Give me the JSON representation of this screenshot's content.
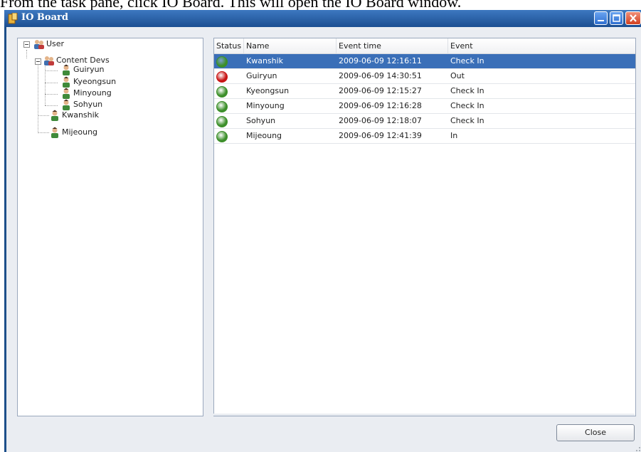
{
  "caption": "From the task pane, click IO Board. This will open the IO Board window.",
  "window": {
    "title": "IO Board"
  },
  "tree": {
    "root": {
      "label": "User"
    },
    "group": {
      "label": "Content Devs"
    },
    "group_members": [
      {
        "label": "Guiryun"
      },
      {
        "label": "Kyeongsun"
      },
      {
        "label": "Minyoung"
      },
      {
        "label": "Sohyun"
      }
    ],
    "others": [
      {
        "label": "Kwanshik"
      },
      {
        "label": "Mijeoung"
      }
    ]
  },
  "grid": {
    "columns": [
      {
        "label": "Status"
      },
      {
        "label": "Name"
      },
      {
        "label": "Event time"
      },
      {
        "label": "Event"
      }
    ],
    "rows": [
      {
        "status": "green",
        "name": "Kwanshik",
        "time": "2009-06-09 12:16:11",
        "event": "Check In",
        "selected": true
      },
      {
        "status": "red",
        "name": "Guiryun",
        "time": "2009-06-09 14:30:51",
        "event": "Out",
        "selected": false
      },
      {
        "status": "green",
        "name": "Kyeongsun",
        "time": "2009-06-09 12:15:27",
        "event": "Check In",
        "selected": false
      },
      {
        "status": "green",
        "name": "Minyoung",
        "time": "2009-06-09 12:16:28",
        "event": "Check In",
        "selected": false
      },
      {
        "status": "green",
        "name": "Sohyun",
        "time": "2009-06-09 12:18:07",
        "event": "Check In",
        "selected": false
      },
      {
        "status": "green",
        "name": "Mijeoung",
        "time": "2009-06-09 12:41:39",
        "event": "In",
        "selected": false
      }
    ]
  },
  "buttons": {
    "close_label": "Close"
  },
  "colors": {
    "status_green": "#3c8f2a",
    "status_red": "#c81414",
    "selection": "#3a6fb8"
  }
}
